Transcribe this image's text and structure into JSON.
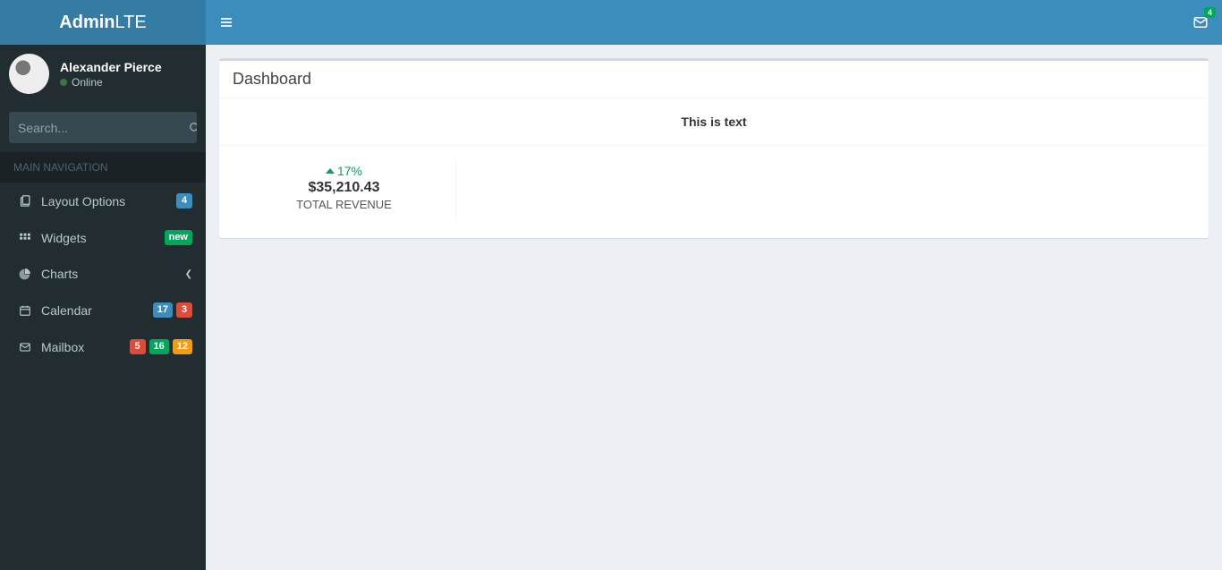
{
  "brand": {
    "bold": "Admin",
    "light": "LTE"
  },
  "user": {
    "name": "Alexander Pierce",
    "status": "Online"
  },
  "search": {
    "placeholder": "Search..."
  },
  "nav_header": "MAIN NAVIGATION",
  "nav": {
    "layout": {
      "label": "Layout Options",
      "badge": "4"
    },
    "widgets": {
      "label": "Widgets",
      "badge": "new"
    },
    "charts": {
      "label": "Charts"
    },
    "calendar": {
      "label": "Calendar",
      "badge1": "17",
      "badge2": "3"
    },
    "mailbox": {
      "label": "Mailbox",
      "badge1": "5",
      "badge2": "16",
      "badge3": "12"
    }
  },
  "topnav": {
    "mail_badge": "4"
  },
  "box": {
    "title": "Dashboard",
    "body_text": "This is text",
    "stat": {
      "percent": "17%",
      "value": "$35,210.43",
      "label": "TOTAL REVENUE"
    }
  }
}
